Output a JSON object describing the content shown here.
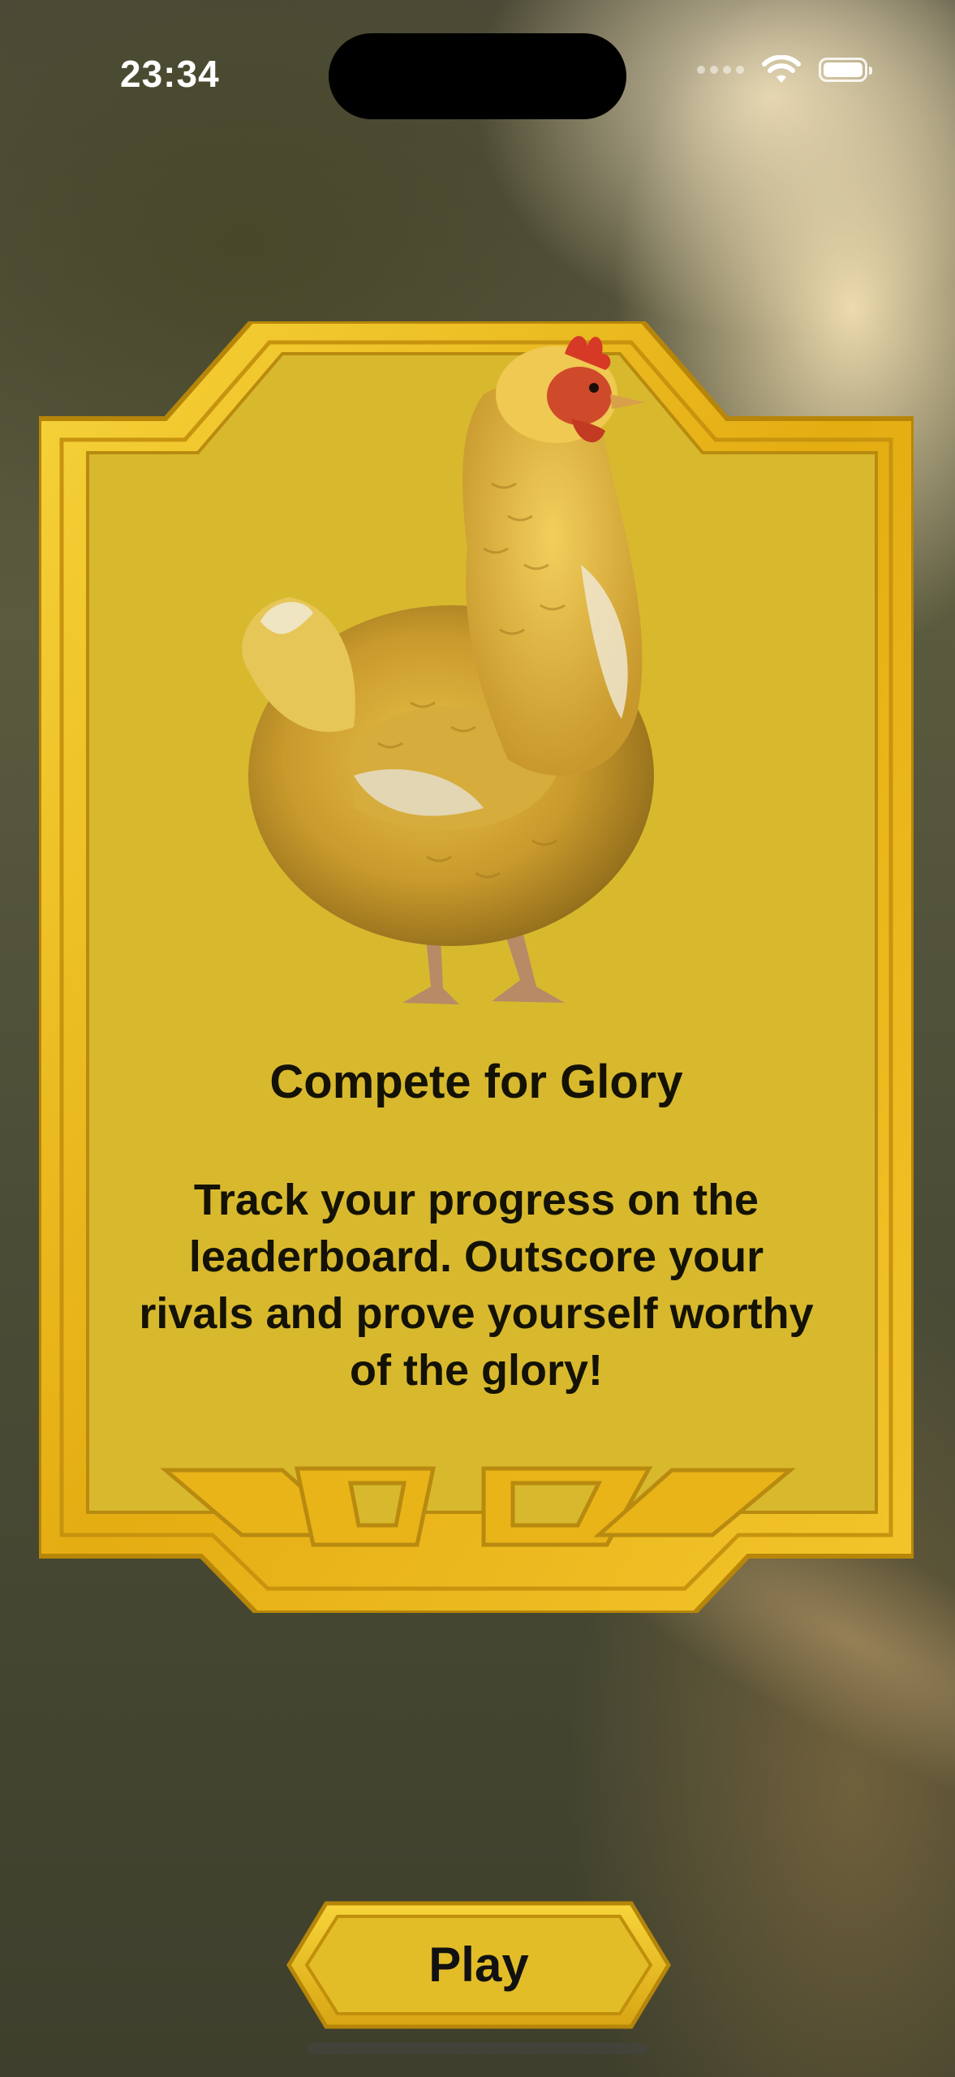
{
  "status_bar": {
    "time": "23:34",
    "icons": [
      "cellular-signal-icon",
      "wifi-icon",
      "battery-icon"
    ]
  },
  "card": {
    "title": "Compete for Glory",
    "body": "Track your progress on the leaderboard. Outscore your rivals and prove yourself worthy of the glory!",
    "image": "chicken-illustration",
    "frame_color": "#e9b61a",
    "panel_color": "#d8b92e"
  },
  "play_button": {
    "label": "Play",
    "color": "#e2bd28"
  }
}
